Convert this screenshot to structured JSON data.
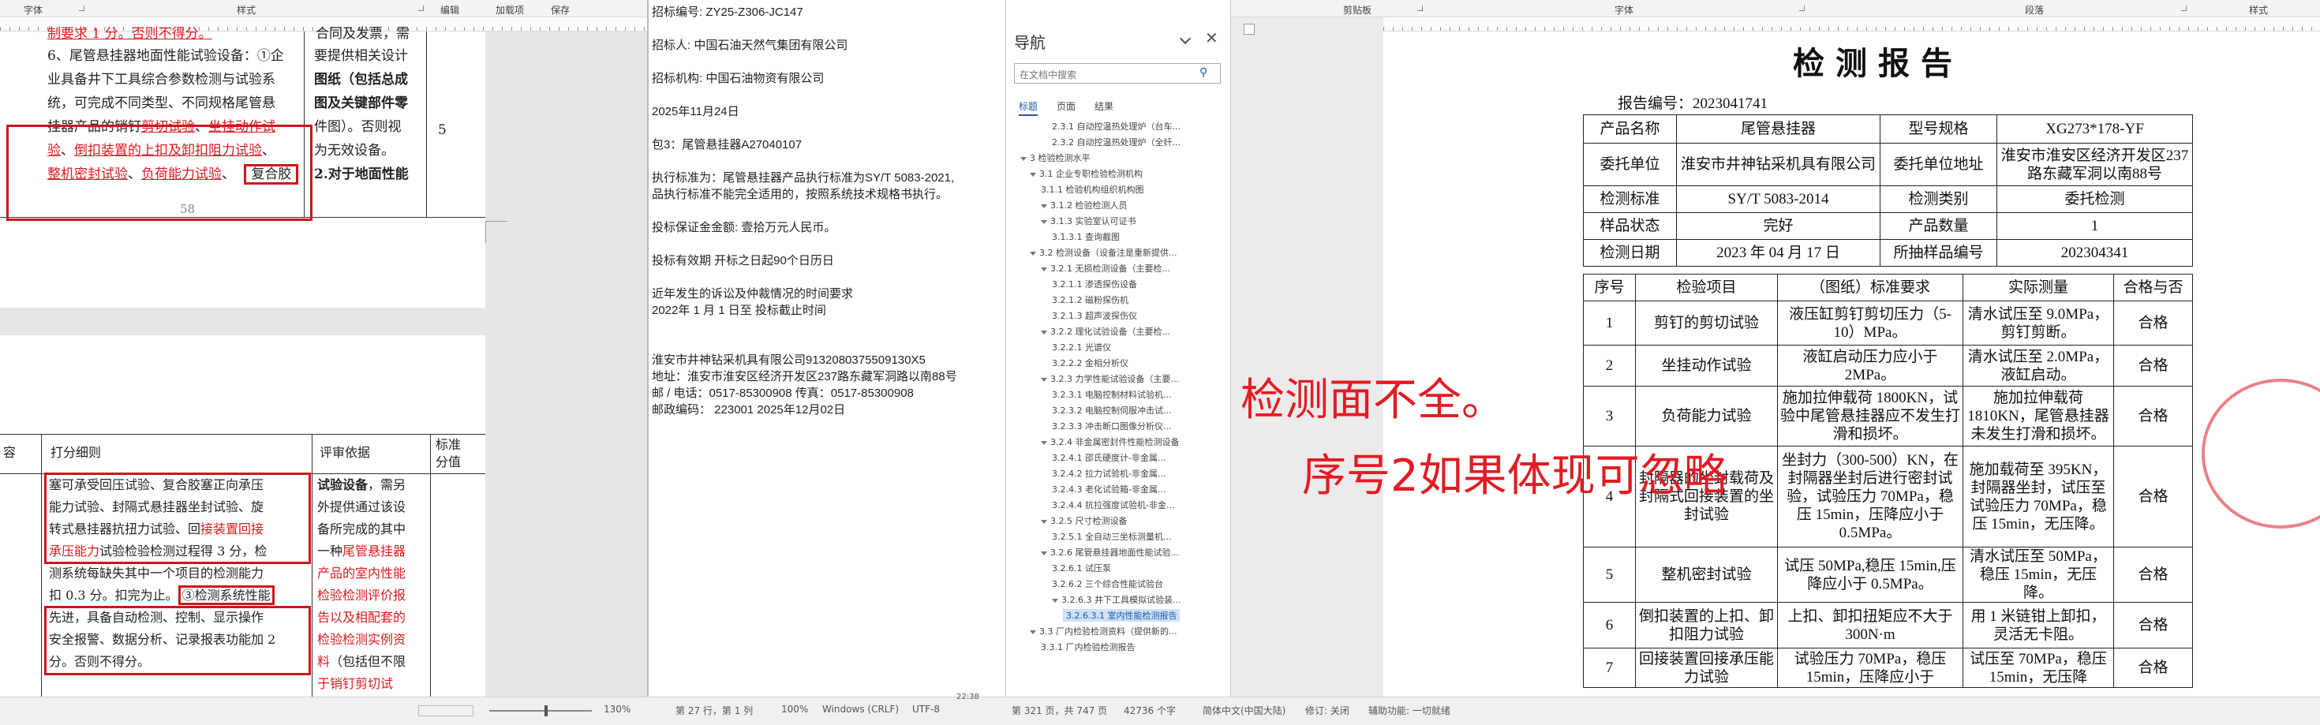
{
  "left_window": {
    "ribbon_labels": [
      "字体",
      "样式",
      "编辑",
      "加载项",
      "保存"
    ],
    "top_fragment": "制要求 1 分。否则不得分。",
    "top_fragment_right": "合同及发票，需",
    "table_top_right_lines": [
      "要提供相关设计",
      "图纸（包括总成",
      "图及关键部件零",
      "件图）。否则视",
      "为无效设备。",
      "2.对于地面性能"
    ],
    "item6_lines": [
      "6、尾管悬挂器地面性能试验设备：①企",
      "业具备井下工具综合参数检测与试验系",
      "统，可完成不同类型、不同规格尾管悬",
      "挂器产品的销钉",
      "剪切试验",
      "、",
      "坐挂动作试",
      "验",
      "、",
      "倒扣装置的上扣及卸扣阻力试验",
      "、",
      "整机密封试验",
      "、",
      "负荷能力试验",
      "、",
      "复合胶"
    ],
    "score_cell": "5",
    "page_number": "58",
    "lower_headers": [
      "容",
      "打分细则",
      "评审依据",
      "标准分值"
    ],
    "lower_lines": [
      "塞可承受回压试验、复合胶塞正向承压",
      "能力试验、封隔式悬挂器坐封试验、旋",
      "转式悬挂器抗扭力试验、回",
      "接装置回接",
      "承压能力",
      "试验检验检测过程得 3 分，检",
      "测系统每缺失其中一个项目的检测能力",
      "扣 0.3 分。扣完为止。",
      "③检测系统性能",
      "先进，具备自动检测、控制、显示操作",
      "安全报警、数据分析、记录报表功能加 2",
      "分。否则不得分。"
    ],
    "lower_right_lines": [
      "试验设备",
      "，需另",
      "外提供通过该设",
      "备所完成的其中",
      "一种",
      "尾管悬挂器",
      "产品的室内性能",
      "检验检测评价报",
      "告以及相配套的",
      "检验检测实例资",
      "料",
      "（包括但不限",
      "于销钉剪切试"
    ],
    "status": {
      "zoom": "130%"
    }
  },
  "middle_window": {
    "lines": [
      "招标编号:  ZY25-Z306-JC147",
      "招标人:   中国石油天然气集团有限公司",
      "招标机构:  中国石油物资有限公司",
      "2025年11月24日",
      "包3：尾管悬挂器A27040107",
      "执行标准为：尾管悬挂器产品执行标准为SY/T 5083-2021,",
      "品执行标准不能完全适用的，按照系统技术规格书执行。",
      "投标保证金金额:  壹拾万元人民币。",
      "投标有效期  开标之日起90个日历日",
      "近年发生的诉讼及仲裁情况的时间要求",
      "2022年 1 月 1 日至 投标截止时间",
      "淮安市井神钻采机具有限公司9132080375509130X5",
      "地址：淮安市淮安区经济开发区237路东藏军洞路以南88号",
      "邮 / 电话：0517-85300908    传真：0517-85300908",
      "邮政编码：     223001               2025年12月02日"
    ],
    "status": [
      "第 27 行，第 1 列",
      "100%",
      "Windows (CRLF)",
      "UTF-8"
    ],
    "clock": "22:38"
  },
  "nav": {
    "title": "导航",
    "search_placeholder": "在文档中搜索",
    "tabs": [
      "标题",
      "页面",
      "结果"
    ],
    "items": [
      {
        "label": "2.3.1 自动控温热处理炉（台车...",
        "level": 4
      },
      {
        "label": "2.3.2 自动控温热处理炉（全纤...",
        "level": 4
      },
      {
        "label": "3 检验检测水平",
        "level": 1,
        "expanded": true
      },
      {
        "label": "3.1 企业专职检验检测机构",
        "level": 2,
        "expanded": true
      },
      {
        "label": "3.1.1 检验机构组织机构图",
        "level": 3
      },
      {
        "label": "3.1.2 检验检测人员",
        "level": 3,
        "expanded": true
      },
      {
        "label": "3.1.3 实验室认可证书",
        "level": 3,
        "expanded": true
      },
      {
        "label": "3.1.3.1 查询截图",
        "level": 4
      },
      {
        "label": "3.2 检测设备（设备注是重新提供...",
        "level": 2,
        "expanded": true
      },
      {
        "label": "3.2.1 无损检测设备（主要检...",
        "level": 3,
        "expanded": true
      },
      {
        "label": "3.2.1.1 渗透探伤设备",
        "level": 4
      },
      {
        "label": "3.2.1.2 磁粉探伤机",
        "level": 4
      },
      {
        "label": "3.2.1.3 超声波探伤仪",
        "level": 4
      },
      {
        "label": "3.2.2 理化试验设备（主要检...",
        "level": 3,
        "expanded": true
      },
      {
        "label": "3.2.2.1 光谱仪",
        "level": 4
      },
      {
        "label": "3.2.2.2 金相分析仪",
        "level": 4
      },
      {
        "label": "3.2.3 力学性能试验设备（主要...",
        "level": 3,
        "expanded": true
      },
      {
        "label": "3.2.3.1 电脑控制材料试验机...",
        "level": 4
      },
      {
        "label": "3.2.3.2 电脑控制伺服冲击试...",
        "level": 4
      },
      {
        "label": "3.2.3.3 冲击断口图像分析仪...",
        "level": 4
      },
      {
        "label": "3.2.4 非金属密封件性能检测设备",
        "level": 3,
        "expanded": true
      },
      {
        "label": "3.2.4.1 邵氏硬度计-非金属...",
        "level": 4
      },
      {
        "label": "3.2.4.2 拉力试验机-非金属...",
        "level": 4
      },
      {
        "label": "3.2.4.3 老化试验箱-非金属...",
        "level": 4
      },
      {
        "label": "3.2.4.4 抗拉强度试验机-非金...",
        "level": 4
      },
      {
        "label": "3.2.5 尺寸检测设备",
        "level": 3,
        "expanded": true
      },
      {
        "label": "3.2.5.1 全自动三坐标测量机...",
        "level": 4
      },
      {
        "label": "3.2.6 尾管悬挂器地面性能试验...",
        "level": 3,
        "expanded": true
      },
      {
        "label": "3.2.6.1 试压泵",
        "level": 4
      },
      {
        "label": "3.2.6.2 三个综合性能试验台",
        "level": 4
      },
      {
        "label": "3.2.6.3 井下工具模拟试验装...",
        "level": 4,
        "expanded": true
      },
      {
        "label": "3.2.6.3.1 室内性能检测报告",
        "level": 5,
        "selected": true
      },
      {
        "label": "3.3 厂内检验检测资料（提供新的...",
        "level": 2,
        "expanded": true
      },
      {
        "label": "3.3.1 厂内检验检测报告",
        "level": 3
      }
    ]
  },
  "report": {
    "ribbon_labels": [
      "剪贴板",
      "字体",
      "段落",
      "样式"
    ],
    "title": "检 测 报 告",
    "report_no": "报告编号：2023041741",
    "info": [
      [
        "产品名称",
        "尾管悬挂器",
        "型号规格",
        "XG273*178-YF"
      ],
      [
        "委托单位",
        "淮安市井神钻采机具有限公司",
        "委托单位地址",
        "淮安市淮安区经济开发区237路东藏军洞以南88号"
      ],
      [
        "检测标准",
        "SY/T  5083-2014",
        "检测类别",
        "委托检测"
      ],
      [
        "样品状态",
        "完好",
        "产品数量",
        "1"
      ],
      [
        "检测日期",
        "2023 年 04 月 17 日",
        "所抽样品编号",
        "202304341"
      ]
    ],
    "headers": [
      "序号",
      "检验项目",
      "（图纸）标准要求",
      "实际测量",
      "合格与否"
    ],
    "rows": [
      [
        "1",
        "剪钉的剪切试验",
        "液压缸剪钉剪切压力（5-10）MPa。",
        "清水试压至 9.0MPa，剪钉剪断。",
        "合格"
      ],
      [
        "2",
        "坐挂动作试验",
        "液缸启动压力应小于 2MPa。",
        "清水试压至 2.0MPa，液缸启动。",
        "合格"
      ],
      [
        "3",
        "负荷能力试验",
        "施加拉伸载荷 1800KN，试验中尾管悬挂器应不发生打滑和损坏。",
        "施加拉伸载荷 1810KN，尾管悬挂器未发生打滑和损坏。",
        "合格"
      ],
      [
        "4",
        "封隔器的坐封载荷及封隔式回接装置的坐封试验",
        "坐封力（300-500）KN，在封隔器坐封后进行密封试验，试验压力 70MPa，稳压 15min，压降应小于 0.5MPa。",
        "施加载荷至 395KN，封隔器坐封，试压至试验压力 70MPa，稳压 15min，无压降。",
        "合格"
      ],
      [
        "5",
        "整机密封试验",
        "试压 50MPa,稳压 15min,压降应小于 0.5MPa。",
        "清水试压至 50MPa，稳压 15min，无压降。",
        "合格"
      ],
      [
        "6",
        "倒扣装置的上扣、卸扣阻力试验",
        "上扣、卸扣扭矩应不大于 300N·m",
        "用 1 米链钳上卸扣，灵活无卡阻。",
        "合格"
      ],
      [
        "7",
        "回接装置回接承压能力试验",
        "试验压力 70MPa，稳压 15min，压降应小于",
        "试压至 70MPa，稳压 15min，无压降",
        "合格"
      ]
    ],
    "annotation_1": "检测面不全。",
    "annotation_2": "序号2如果体现可忽略",
    "status": [
      "第 321 页，共 747 页",
      "42736 个字",
      "简体中文(中国大陆)",
      "修订: 关闭",
      "辅助功能: 一切就绪"
    ]
  }
}
